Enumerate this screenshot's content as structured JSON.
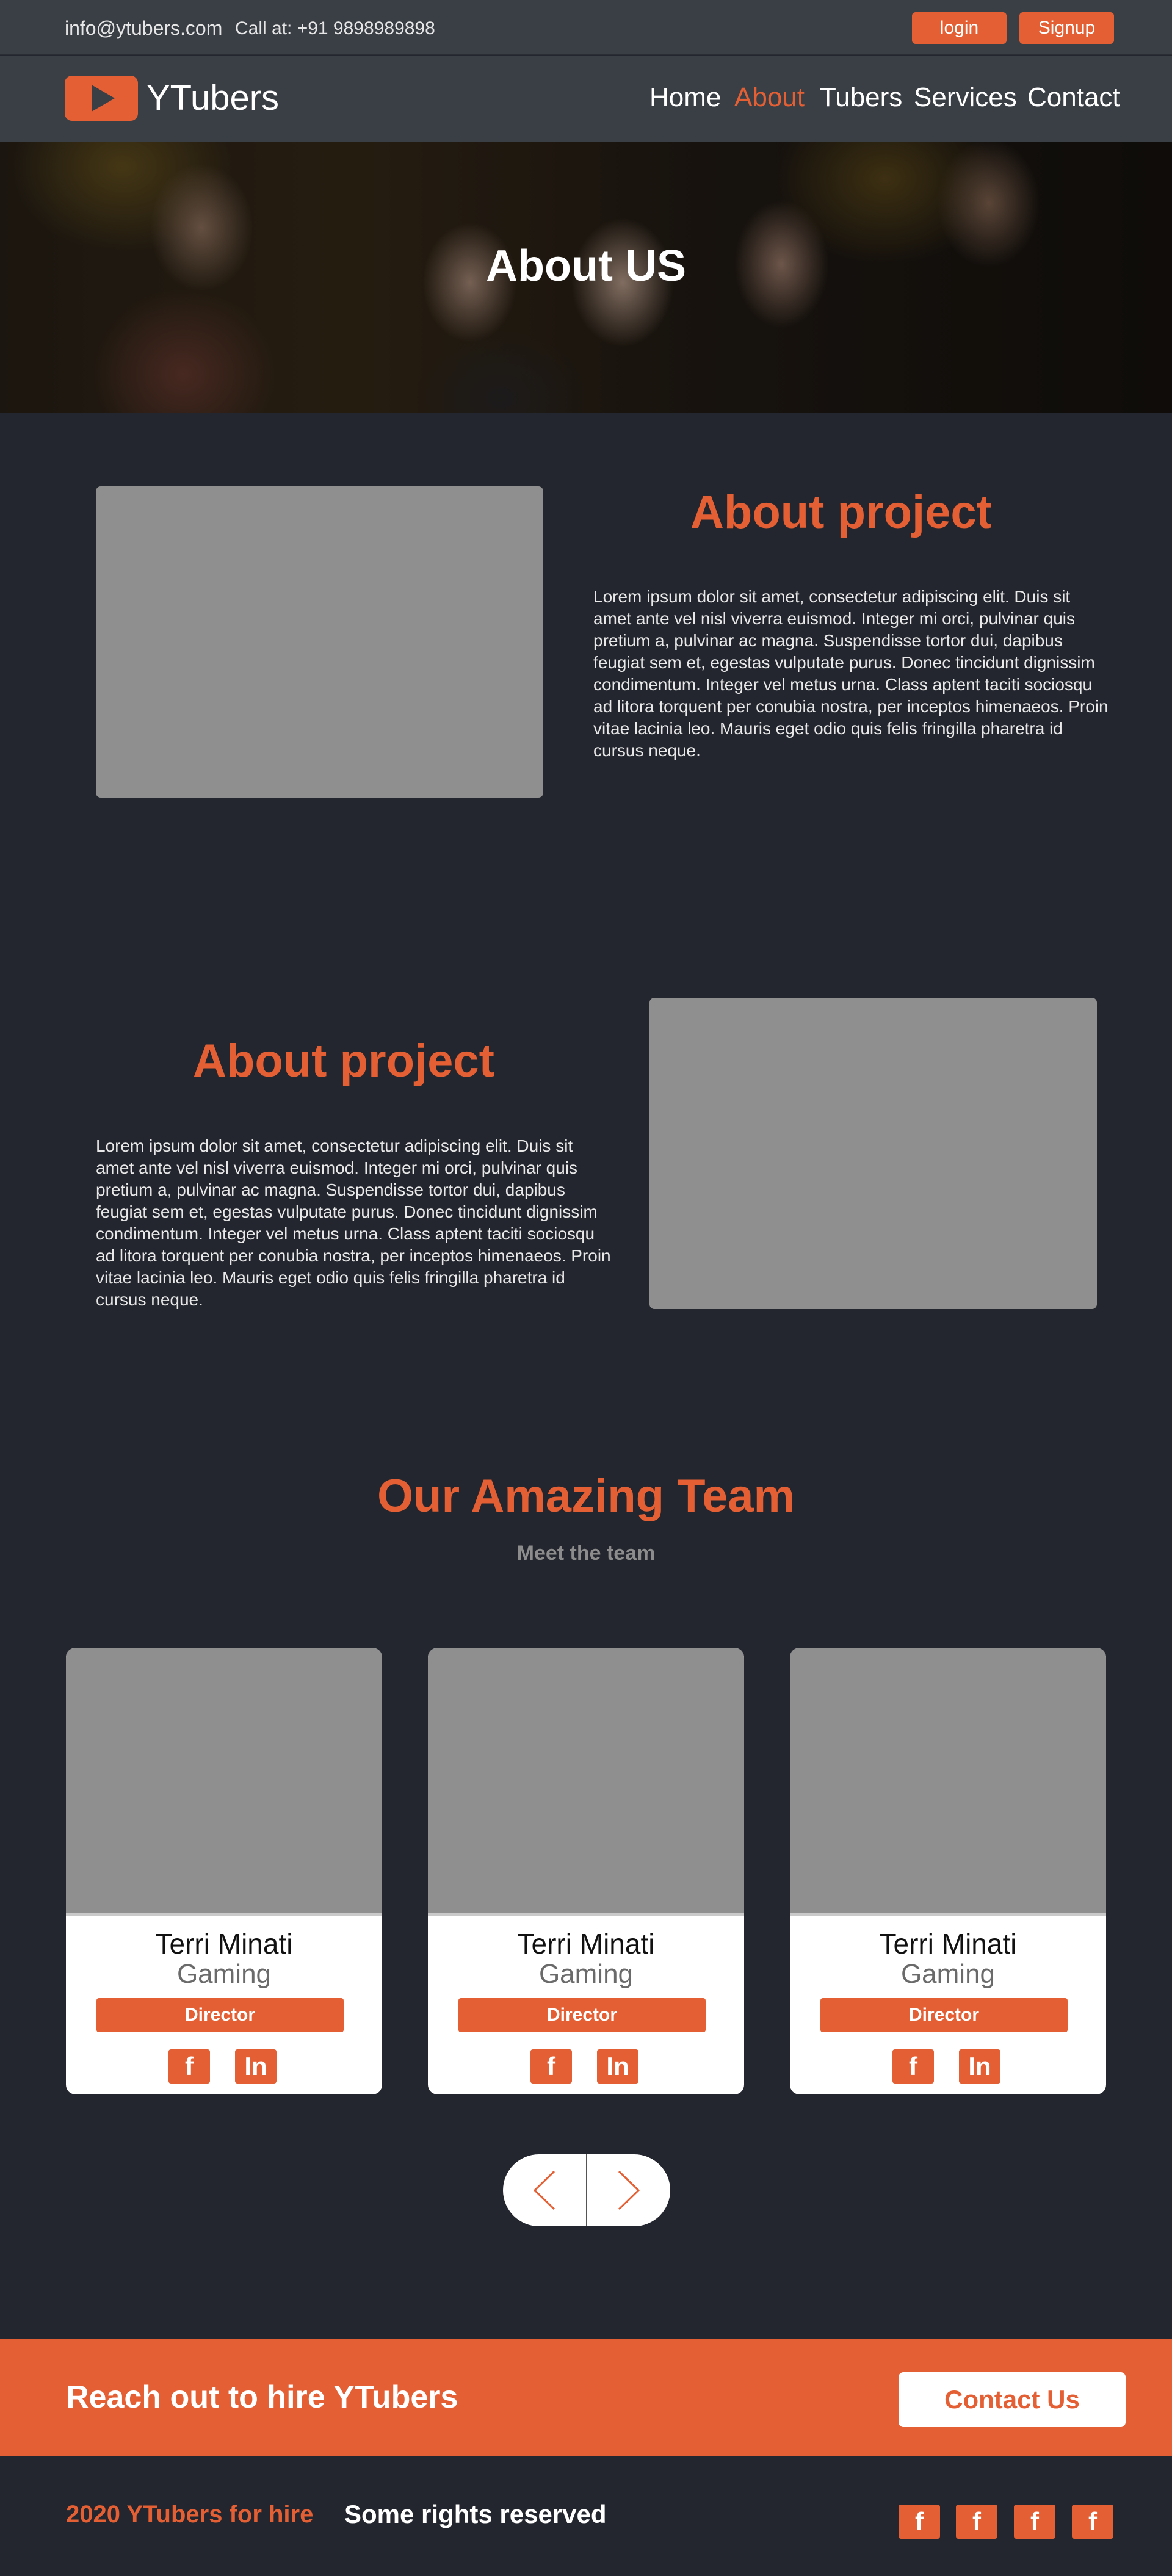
{
  "topbar": {
    "email": "info@ytubers.com",
    "phone": "Call at: +91 9898989898",
    "login_label": "login",
    "signup_label": "Signup"
  },
  "nav": {
    "brand": "YTubers",
    "logo_icon": "play-icon",
    "items": [
      {
        "label": "Home",
        "active": false
      },
      {
        "label": "About",
        "active": true
      },
      {
        "label": "Tubers",
        "active": false
      },
      {
        "label": "Services",
        "active": false
      },
      {
        "label": "Contact",
        "active": false
      }
    ]
  },
  "hero": {
    "title": "About US"
  },
  "about_sections": [
    {
      "title": "About project",
      "text": "Lorem ipsum dolor sit amet, consectetur adipiscing elit. Duis sit amet ante vel nisl viverra euismod. Integer mi orci, pulvinar quis pretium a, pulvinar ac magna. Suspendisse tortor dui, dapibus feugiat sem et, egestas vulputate purus. Donec tincidunt dignissim condimentum. Integer vel metus urna. Class aptent taciti sociosqu ad litora torquent per conubia nostra, per inceptos himenaeos. Proin vitae lacinia leo. Mauris eget odio quis felis fringilla pharetra id cursus neque."
    },
    {
      "title": "About project",
      "text": "Lorem ipsum dolor sit amet, consectetur adipiscing elit. Duis sit amet ante vel nisl viverra euismod. Integer mi orci, pulvinar quis pretium a, pulvinar ac magna. Suspendisse tortor dui, dapibus feugiat sem et, egestas vulputate purus. Donec tincidunt dignissim condimentum. Integer vel metus urna. Class aptent taciti sociosqu ad litora torquent per conubia nostra, per inceptos himenaeos. Proin vitae lacinia leo. Mauris eget odio quis felis fringilla pharetra id cursus neque."
    }
  ],
  "team": {
    "title": "Our Amazing Team",
    "subtitle": "Meet the team",
    "members": [
      {
        "name": "Terri Minati",
        "category": "Gaming",
        "role": "Director",
        "social": [
          "f",
          "In"
        ]
      },
      {
        "name": "Terri Minati",
        "category": "Gaming",
        "role": "Director",
        "social": [
          "f",
          "In"
        ]
      },
      {
        "name": "Terri Minati",
        "category": "Gaming",
        "role": "Director",
        "social": [
          "f",
          "In"
        ]
      }
    ],
    "slider_icons": [
      "chevron-left-icon",
      "chevron-right-icon"
    ]
  },
  "cta": {
    "text": "Reach out to hire YTubers",
    "button": "Contact Us"
  },
  "footer": {
    "copyright": "2020 YTubers for hire",
    "rights": "Some rights reserved",
    "social": [
      "f",
      "f",
      "f",
      "f"
    ]
  },
  "colors": {
    "accent": "#e46034",
    "background": "#23262e",
    "header": "#3a3f46",
    "placeholder": "#8f8f8f"
  }
}
